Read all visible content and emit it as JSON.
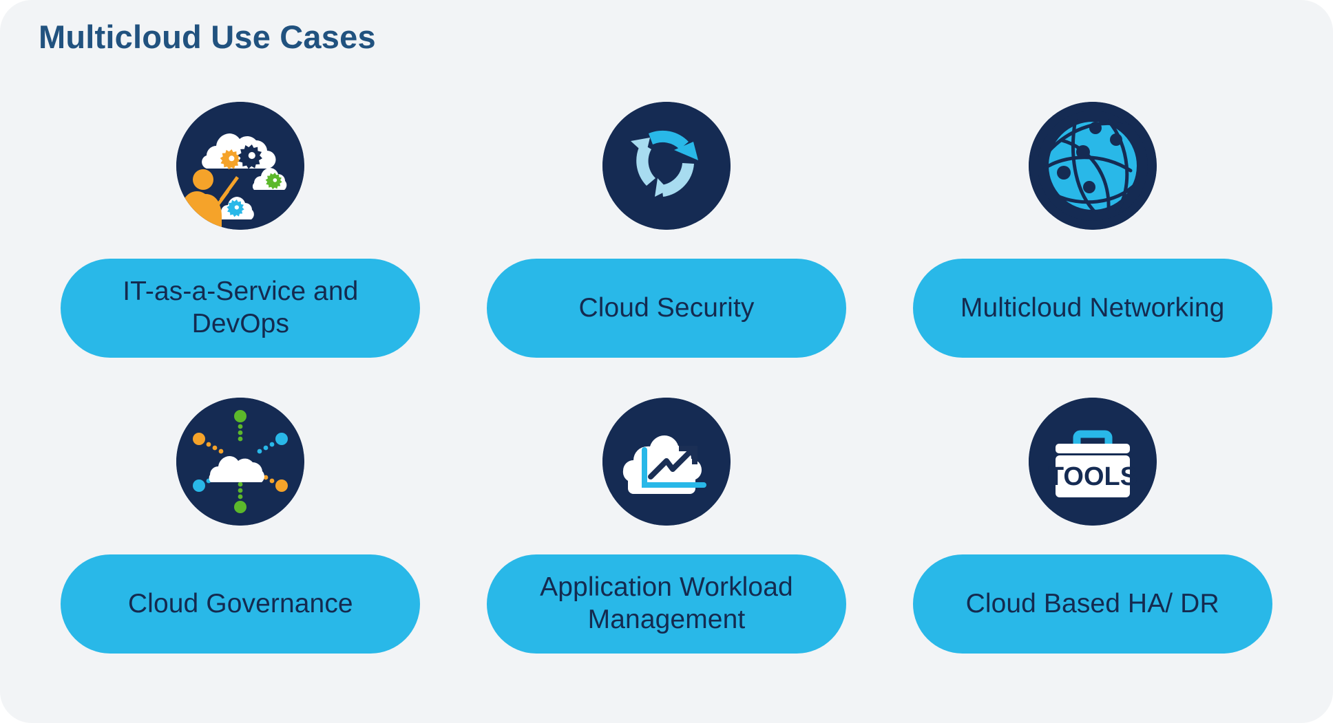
{
  "page": {
    "title": "Multicloud Use Cases",
    "card_background": "#f2f4f6",
    "outer_background": "#ffffff",
    "title_color": "#21527f"
  },
  "theme": {
    "pill_fill": "#29b8e8",
    "pill_text": "#142a4f",
    "icon_circle_fill": "#152b53",
    "accent_cyan": "#29b8e8",
    "accent_light_blue": "#a8dcf0",
    "accent_orange": "#f5a32a",
    "accent_green": "#5cb82b",
    "accent_white": "#ffffff"
  },
  "use_cases": [
    {
      "label": "IT-as-a-Service and DevOps",
      "icon": "clouds-gears-person-icon",
      "lines": [
        "IT-as-a-Service and",
        "DevOps"
      ]
    },
    {
      "label": "Cloud Security",
      "icon": "circular-arrows-refresh-icon",
      "lines": [
        "Cloud Security"
      ]
    },
    {
      "label": "Multicloud Networking",
      "icon": "network-globe-icon",
      "lines": [
        "Multicloud Networking"
      ]
    },
    {
      "label": "Cloud Governance",
      "icon": "cloud-radiating-nodes-icon",
      "lines": [
        "Cloud Governance"
      ]
    },
    {
      "label": "Application Workload Management",
      "icon": "cloud-growth-chart-icon",
      "lines": [
        "Application Workload",
        "Management"
      ]
    },
    {
      "label": "Cloud Based HA/ DR",
      "icon": "toolbox-tools-icon",
      "lines": [
        "Cloud Based HA/ DR"
      ],
      "icon_text": "TOOLS"
    }
  ]
}
